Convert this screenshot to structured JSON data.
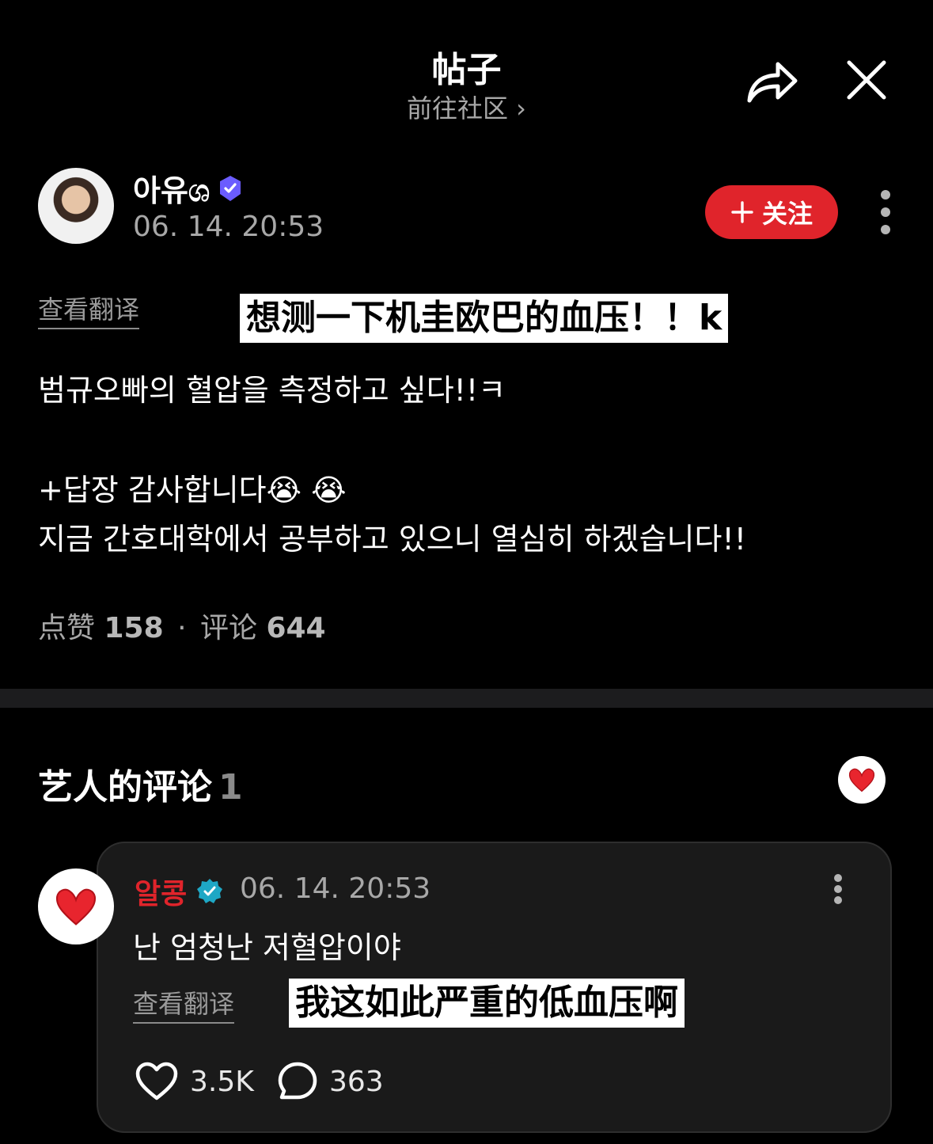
{
  "header": {
    "title": "帖子",
    "subtitle": "前往社区 ›",
    "share_icon": "share-arrow-icon",
    "close_icon": "close-icon"
  },
  "post": {
    "author": "아유ශ",
    "time": "06. 14. 20:53",
    "follow_label": "关注",
    "translate_label": "查看翻译",
    "translation_overlay": "想测一下机圭欧巴的血压！！k",
    "lines": [
      "범규오빠의 혈압을 측정하고 싶다!!ㅋ",
      "",
      "+답장 감사합니다😭 😭",
      "지금 간호대학에서 공부하고 있으니 열심히 하겠습니다!!"
    ],
    "stats": {
      "likes_label": "点赞",
      "likes": "158",
      "sep": "·",
      "comments_label": "评论",
      "comments": "644"
    }
  },
  "artist_comments": {
    "title": "艺人的评论",
    "count": "1"
  },
  "comment": {
    "author": "알콩",
    "time": "06. 14. 20:53",
    "text": "난 엄청난 저혈압이야",
    "translate_label": "查看翻译",
    "translation_overlay": "我这如此严重的低血压啊",
    "likes": "3.5K",
    "replies": "363"
  },
  "colors": {
    "accent": "#e0242b",
    "verified_purple": "#6b5cff",
    "verified_cyan": "#1ea7c5",
    "divider": "#1c1c1e"
  }
}
